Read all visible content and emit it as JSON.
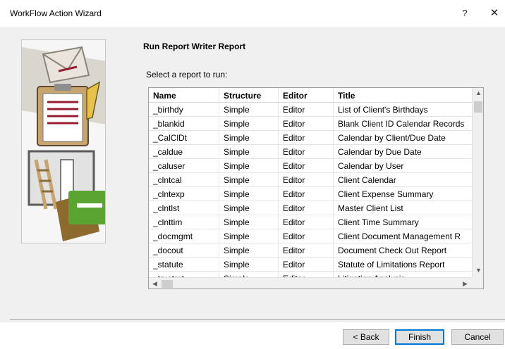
{
  "window": {
    "title": "WorkFlow Action Wizard",
    "help_label": "?",
    "close_label": "✕"
  },
  "section_title": "Run Report Writer Report",
  "prompt": "Select a report to run:",
  "grid": {
    "columns": [
      "Name",
      "Structure",
      "Editor",
      "Title"
    ],
    "rows": [
      [
        "_birthdy",
        "Simple",
        "Editor",
        "List of Client's Birthdays"
      ],
      [
        "_blankid",
        "Simple",
        "Editor",
        "Blank Client ID Calendar Records"
      ],
      [
        "_CalClDt",
        "Simple",
        "Editor",
        "Calendar by Client/Due Date"
      ],
      [
        "_caldue",
        "Simple",
        "Editor",
        "Calendar by Due Date"
      ],
      [
        "_caluser",
        "Simple",
        "Editor",
        "Calendar by User"
      ],
      [
        "_clntcal",
        "Simple",
        "Editor",
        "Client Calendar"
      ],
      [
        "_clntexp",
        "Simple",
        "Editor",
        "Client Expense Summary"
      ],
      [
        "_clntlst",
        "Simple",
        "Editor",
        "Master Client List"
      ],
      [
        "_clnttim",
        "Simple",
        "Editor",
        "Client Time Summary"
      ],
      [
        "_docmgmt",
        "Simple",
        "Editor",
        "Client Document Management R"
      ],
      [
        "_docout",
        "Simple",
        "Editor",
        "Document Check Out Report"
      ],
      [
        "_statute",
        "Simple",
        "Editor",
        "Statute of Limitations Report"
      ],
      [
        "_trustrpt",
        "Simple",
        "Editor",
        "Litigation Analysis"
      ]
    ]
  },
  "buttons": {
    "back": "< Back",
    "finish": "Finish",
    "cancel": "Cancel"
  },
  "colors": {
    "accent": "#0078d7",
    "dialog_bg": "#f0f0f0"
  },
  "icons": {
    "wizard_art": "clipboard-ladder-envelope-illustration"
  }
}
